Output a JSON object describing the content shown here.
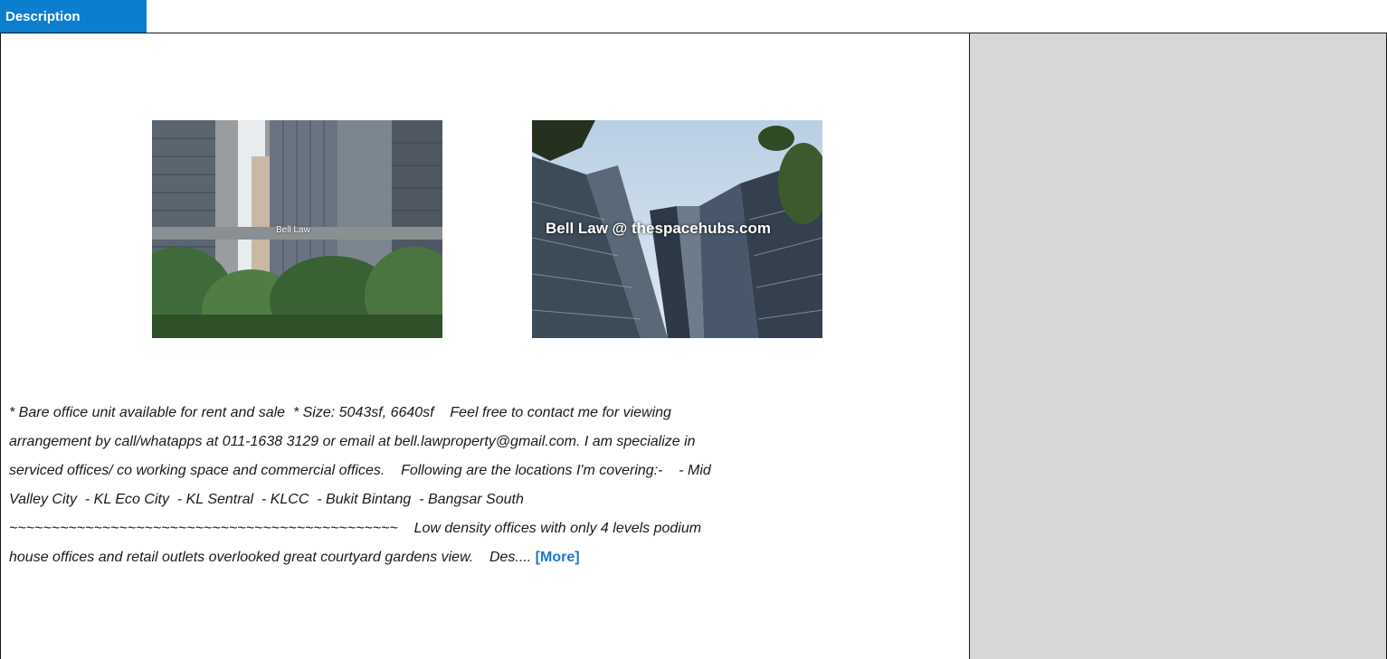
{
  "tab": {
    "label": "Description"
  },
  "photos": [
    {
      "watermark": "Bell Law"
    },
    {
      "watermark": "Bell Law @ thespacehubs.com"
    }
  ],
  "description": {
    "lines": [
      "* Bare office unit available for rent and sale  * Size: 5043sf, 6640sf    Feel free to contact me for viewing",
      "arrangement by call/whatapps at 011-1638 3129 or email at bell.lawproperty@gmail.com. I am specialize in",
      "serviced offices/ co working space and commercial offices.    Following are the locations I'm covering:-    - Mid",
      "Valley City  - KL Eco City  - KL Sentral  - KLCC  - Bukit Bintang  - Bangsar South",
      "~~~~~~~~~~~~~~~~~~~~~~~~~~~~~~~~~~~~~~~~~~~~~~    Low density offices with only 4 levels podium",
      "house offices and retail outlets overlooked great courtyard gardens view.    Des.... "
    ],
    "more_label": "[More]"
  },
  "colors": {
    "tab": "#0b7ed0",
    "link": "#1b77c9",
    "side_panel": "#d7d7d7"
  }
}
